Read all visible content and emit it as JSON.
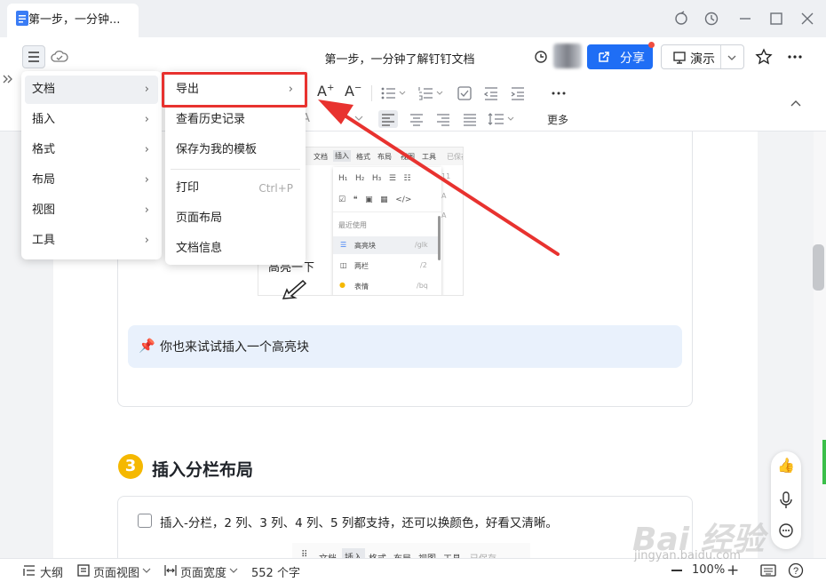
{
  "tab": {
    "title": "第一步，一分钟..."
  },
  "window_icons": [
    "sync-icon",
    "history-icon",
    "minimize-icon",
    "maximize-icon",
    "close-icon"
  ],
  "header": {
    "title": "第一步，一分钟了解钉钉文档",
    "share_label": "分享",
    "present_label": "演示"
  },
  "format_bar": {
    "more_label": "更多"
  },
  "menu_main": {
    "items": [
      {
        "label": "文档"
      },
      {
        "label": "插入"
      },
      {
        "label": "格式"
      },
      {
        "label": "布局"
      },
      {
        "label": "视图"
      },
      {
        "label": "工具"
      }
    ]
  },
  "menu_doc": {
    "export_label": "导出",
    "history_label": "查看历史记录",
    "save_template_label": "保存为我的模板",
    "print_label": "打印",
    "print_shortcut": "Ctrl+P",
    "page_layout_label": "页面布局",
    "doc_info_label": "文档信息"
  },
  "inner_screenshot": {
    "menu": [
      "文档",
      "插入",
      "格式",
      "布局",
      "视图",
      "工具",
      "已保存"
    ],
    "recent_label": "最近使用",
    "items": [
      {
        "label": "高亮块",
        "shortcut": "/glk"
      },
      {
        "label": "两栏",
        "shortcut": "/2"
      },
      {
        "label": "表情",
        "shortcut": "/bq"
      }
    ],
    "handwriting": "高亮一下"
  },
  "document": {
    "highlight_text": "你也来试试插入一个高亮块",
    "section_number": "3",
    "section_title": "插入分栏布局",
    "task_text": "插入-分栏，2 列、3 列、4 列、5 列都支持，还可以换颜色，好看又清晰。",
    "inner_menu2": [
      "文档",
      "插入",
      "格式",
      "布局",
      "视图",
      "工具",
      "已保存"
    ]
  },
  "status": {
    "outline_label": "大纲",
    "page_view_label": "页面视图",
    "page_width_label": "页面宽度",
    "word_count": "552 个字",
    "zoom": "100%"
  },
  "watermark": {
    "main": "Bai 经验",
    "sub": "jingyan.baidu.com"
  },
  "colors": {
    "accent": "#1f6ef5",
    "highlight_box": "#e8322f",
    "arrow": "#e8322f"
  }
}
